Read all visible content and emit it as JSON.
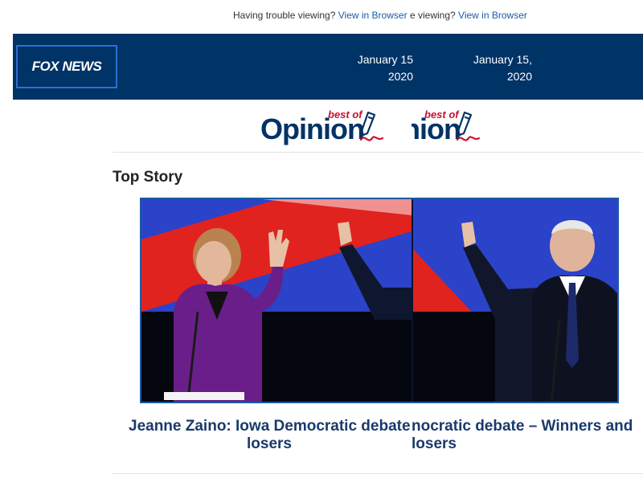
{
  "header_note": {
    "left_prefix": "Having trouble viewing? ",
    "left_link": "View in Browser",
    "right_prefix": "e viewing? ",
    "right_link": "View in Browser"
  },
  "brand": {
    "logo_text": "FOX NEWS"
  },
  "date": {
    "left_line1": "January 15",
    "left_line2": "2020",
    "right_line1": "January 15,",
    "right_line2": "2020"
  },
  "opinion_banner": {
    "word_left": "Opinion",
    "word_right": "inion",
    "best_of": "best of"
  },
  "section": {
    "title": "Top Story"
  },
  "top_story": {
    "image_alt": "Debate stage: Elizabeth Warren and Joe Biden raising hands",
    "headline_left_line1": "Jeanne Zaino: Iowa Democratic debate",
    "headline_left_line2": "losers",
    "headline_right_line1": "nocratic debate – Winners and",
    "headline_right_line2": "losers"
  },
  "colors": {
    "header_bg": "#003366",
    "link": "#1a5aa6",
    "headline": "#1a3a6b",
    "opinion_red": "#c8102e"
  }
}
